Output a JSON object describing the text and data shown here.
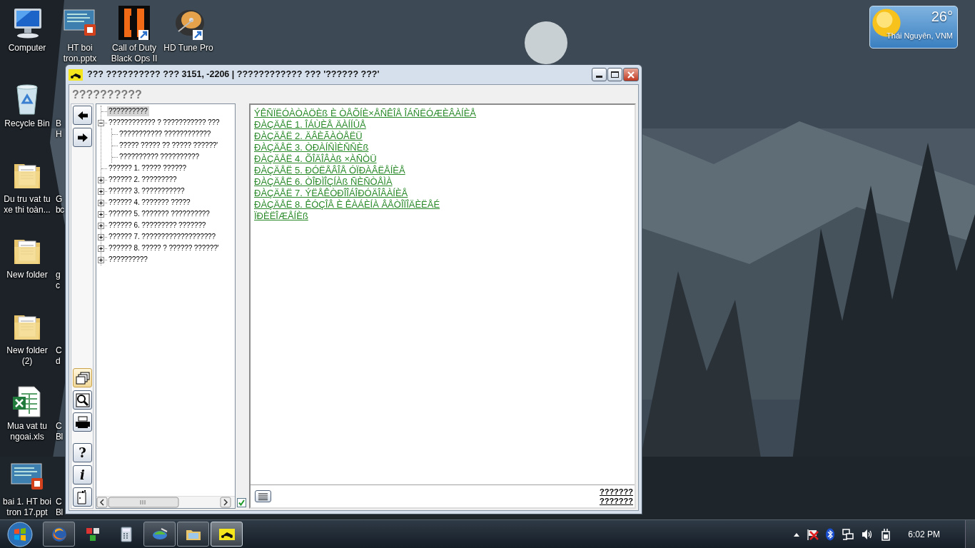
{
  "desktop": {
    "left_column": [
      {
        "kind": "computer",
        "label": "Computer",
        "shortcut": false
      },
      {
        "kind": "recycle-bin",
        "label": "Recycle Bin",
        "shortcut": false
      },
      {
        "kind": "folder",
        "label": "Du tru vat tu xe thi toàn...",
        "shortcut": false
      },
      {
        "kind": "folder",
        "label": "New folder",
        "shortcut": false
      },
      {
        "kind": "folder",
        "label": "New folder (2)",
        "shortcut": false
      },
      {
        "kind": "spreadsheet",
        "label": "Mua vat tu ngoai.xls",
        "shortcut": false
      },
      {
        "kind": "slides",
        "label": "bai 1. HT boi tron 17.ppt",
        "shortcut": false
      }
    ],
    "top_row": [
      {
        "kind": "slides",
        "label": "HT boi tron.pptx",
        "shortcut": false
      },
      {
        "kind": "game",
        "label": "Call of Duty Black Ops II",
        "shortcut": true
      },
      {
        "kind": "disk",
        "label": "HD Tune Pro",
        "shortcut": true
      }
    ],
    "partial_column": [
      {
        "lines": [
          "B",
          "H"
        ]
      },
      {
        "lines": [
          "G",
          "bc"
        ]
      },
      {
        "lines": [
          "g",
          "c"
        ]
      },
      {
        "lines": [
          "C",
          "d"
        ]
      },
      {
        "lines": [
          "C",
          "Bl"
        ]
      },
      {
        "lines": [
          "C",
          "Bl"
        ]
      }
    ]
  },
  "weather": {
    "temperature": "26°",
    "location": "Thái Nguyên, VNM"
  },
  "window": {
    "title": "??? ?????????? ??? 3151, -2206 | ???????????? ??? '?????? ???'",
    "heading": "??????????",
    "toolbar": [
      {
        "kind": "back",
        "selected": false
      },
      {
        "kind": "forward",
        "selected": false
      },
      {
        "kind": "folders",
        "selected": true
      },
      {
        "kind": "search",
        "selected": false
      },
      {
        "kind": "print",
        "selected": false
      },
      {
        "kind": "help",
        "label": "?",
        "selected": false
      },
      {
        "kind": "info",
        "label": "i",
        "selected": false
      },
      {
        "kind": "exit",
        "selected": false
      }
    ],
    "tree": [
      {
        "kind": "leaf",
        "label": "??????????",
        "selected": true
      },
      {
        "kind": "branch",
        "label": "???????????? ? ??????????? ???",
        "expanded": true,
        "selected": false,
        "children": [
          {
            "kind": "leaf",
            "label": "??????????? ????????????",
            "selected": false
          },
          {
            "kind": "leaf",
            "label": "????? ????? ?? ????? ??????'",
            "selected": false
          },
          {
            "kind": "leaf",
            "label": "?????????? ??????????",
            "selected": false
          }
        ]
      },
      {
        "kind": "leaf",
        "label": "?????? 1. ????? ??????",
        "selected": false
      },
      {
        "kind": "branch",
        "label": "?????? 2. ?????????",
        "expanded": false,
        "selected": false
      },
      {
        "kind": "branch",
        "label": "?????? 3. ???????????",
        "expanded": false,
        "selected": false
      },
      {
        "kind": "branch",
        "label": "?????? 4. ??????? ?????",
        "expanded": false,
        "selected": false
      },
      {
        "kind": "branch",
        "label": "?????? 5. ??????? ??????????",
        "expanded": false,
        "selected": false
      },
      {
        "kind": "branch",
        "label": "?????? 6. ????????? ???????",
        "expanded": false,
        "selected": false
      },
      {
        "kind": "branch",
        "label": "?????? 7. ???????????????????",
        "expanded": false,
        "selected": false
      },
      {
        "kind": "branch",
        "label": "?????? 8. ????? ? ?????? ??????'",
        "expanded": false,
        "selected": false
      },
      {
        "kind": "branch",
        "label": "??????????",
        "expanded": false,
        "selected": false
      }
    ],
    "sync_checkbox": {
      "checked": true
    },
    "links": [
      "ÝÊÑÏËÓÀÒÀÖÈß È ÒÅÕÍÈ×ÅÑÊÎÅ ÎÁÑËÓÆÈÂÀÍÈÅ",
      "ÐÀÇÄÅË 1. ÎÁÙÈÅ ÄÀÍÍÛÅ",
      "ÐÀÇÄÅË 2. ÄÂÈÃÀÒÅËÜ",
      "ÐÀÇÄÅË 3. ÒÐÀÍÑÌÈÑÑÈß",
      "ÐÀÇÄÅË 4. ÕÎÄÎÂÀß ×ÀÑÒÜ",
      "ÐÀÇÄÅË 5. ÐÓËÅÂÎÅ ÓÏÐÀÂËÅÍÈÅ",
      "ÐÀÇÄÅË 6. ÒÎÐÌÎÇÍÀß ÑÈÑÒÅÌÀ",
      "ÐÀÇÄÅË 7. ÝËÅÊÒÐÎÎÁÎÐÓÄÎÂÀÍÈÅ",
      "ÐÀÇÄÅË 8. ÊÓÇÎÂ È ÊÀÁÈÍÀ ÂÅÒÎÏÎÄÈËÅÉ",
      "ÏÐÈËÎÆÅÍÈß"
    ],
    "footer_links": [
      "???????",
      "???????"
    ]
  },
  "taskbar": {
    "items": [
      {
        "kind": "browser",
        "running": true,
        "selected": false
      },
      {
        "kind": "network-app",
        "running": false,
        "selected": false
      },
      {
        "kind": "calculator",
        "running": false,
        "selected": false
      },
      {
        "kind": "globe-app",
        "running": true,
        "selected": false
      },
      {
        "kind": "explorer",
        "running": true,
        "selected": false
      },
      {
        "kind": "manual-app",
        "running": true,
        "selected": true
      }
    ],
    "clock": "6:02 PM"
  }
}
